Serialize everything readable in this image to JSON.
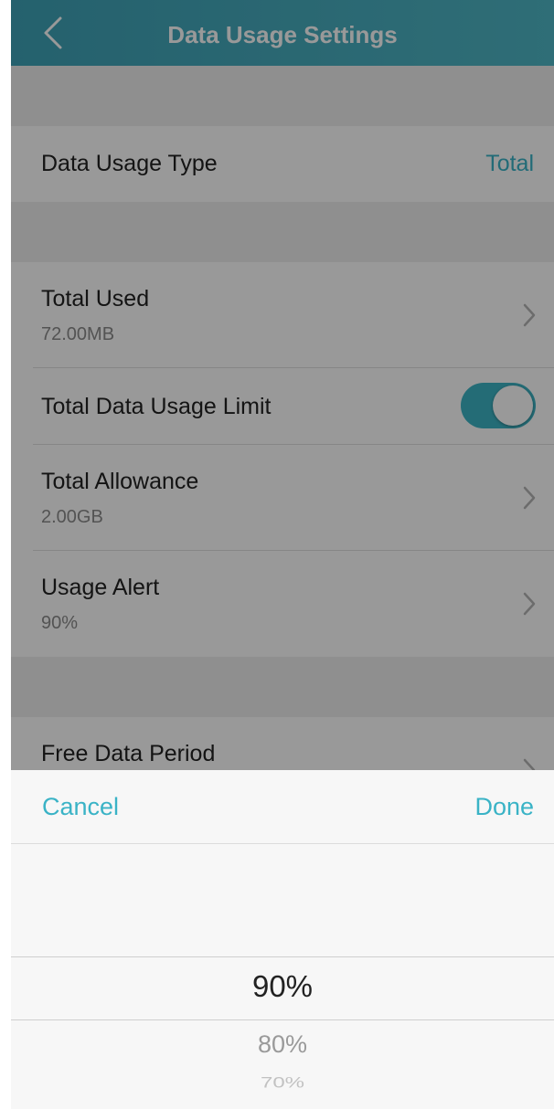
{
  "header": {
    "title": "Data Usage Settings"
  },
  "settings": {
    "type_label": "Data Usage Type",
    "type_value": "Total",
    "used_label": "Total Used",
    "used_value": "72.00MB",
    "limit_label": "Total Data Usage Limit",
    "limit_enabled": true,
    "allowance_label": "Total Allowance",
    "allowance_value": "2.00GB",
    "alert_label": "Usage Alert",
    "alert_value": "90%",
    "free_label": "Free Data Period"
  },
  "picker": {
    "cancel": "Cancel",
    "done": "Done",
    "selected": "90%",
    "next1": "80%",
    "next2": "70%"
  },
  "colors": {
    "accent": "#3ab3c6",
    "header": "#45aebe"
  }
}
